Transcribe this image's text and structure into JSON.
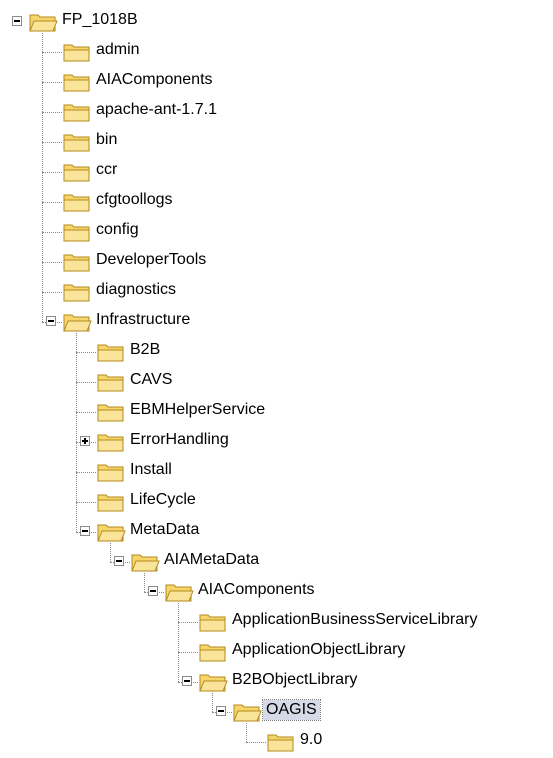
{
  "tree": {
    "nodes": [
      {
        "label": "FP_1018B",
        "depth": 0,
        "expander": "minus",
        "open": true
      },
      {
        "label": "admin",
        "depth": 1,
        "expander": "none",
        "open": false
      },
      {
        "label": "AIAComponents",
        "depth": 1,
        "expander": "none",
        "open": false
      },
      {
        "label": "apache-ant-1.7.1",
        "depth": 1,
        "expander": "none",
        "open": false
      },
      {
        "label": "bin",
        "depth": 1,
        "expander": "none",
        "open": false
      },
      {
        "label": "ccr",
        "depth": 1,
        "expander": "none",
        "open": false
      },
      {
        "label": "cfgtoollogs",
        "depth": 1,
        "expander": "none",
        "open": false
      },
      {
        "label": "config",
        "depth": 1,
        "expander": "none",
        "open": false
      },
      {
        "label": "DeveloperTools",
        "depth": 1,
        "expander": "none",
        "open": false
      },
      {
        "label": "diagnostics",
        "depth": 1,
        "expander": "none",
        "open": false
      },
      {
        "label": "Infrastructure",
        "depth": 1,
        "expander": "minus",
        "open": true
      },
      {
        "label": "B2B",
        "depth": 2,
        "expander": "none",
        "open": false
      },
      {
        "label": "CAVS",
        "depth": 2,
        "expander": "none",
        "open": false
      },
      {
        "label": "EBMHelperService",
        "depth": 2,
        "expander": "none",
        "open": false
      },
      {
        "label": "ErrorHandling",
        "depth": 2,
        "expander": "plus",
        "open": false
      },
      {
        "label": "Install",
        "depth": 2,
        "expander": "none",
        "open": false
      },
      {
        "label": "LifeCycle",
        "depth": 2,
        "expander": "none",
        "open": false
      },
      {
        "label": "MetaData",
        "depth": 2,
        "expander": "minus",
        "open": true
      },
      {
        "label": "AIAMetaData",
        "depth": 3,
        "expander": "minus",
        "open": true
      },
      {
        "label": "AIAComponents",
        "depth": 4,
        "expander": "minus",
        "open": true
      },
      {
        "label": "ApplicationBusinessServiceLibrary",
        "depth": 5,
        "expander": "none",
        "open": false
      },
      {
        "label": "ApplicationObjectLibrary",
        "depth": 5,
        "expander": "none",
        "open": false
      },
      {
        "label": "B2BObjectLibrary",
        "depth": 5,
        "expander": "minus",
        "open": true
      },
      {
        "label": "OAGIS",
        "depth": 6,
        "expander": "minus",
        "open": true,
        "selected": true
      },
      {
        "label": "9.0",
        "depth": 7,
        "expander": "none",
        "open": false
      }
    ]
  },
  "colors": {
    "folder_fill": "#f6d66b",
    "folder_front": "#f9e49a",
    "folder_stroke": "#b38a1f",
    "selection_bg": "#d6d9e6"
  },
  "icons": {
    "folder": "folder-icon",
    "open_folder": "open-folder-icon",
    "expand": "plus-icon",
    "collapse": "minus-icon"
  }
}
